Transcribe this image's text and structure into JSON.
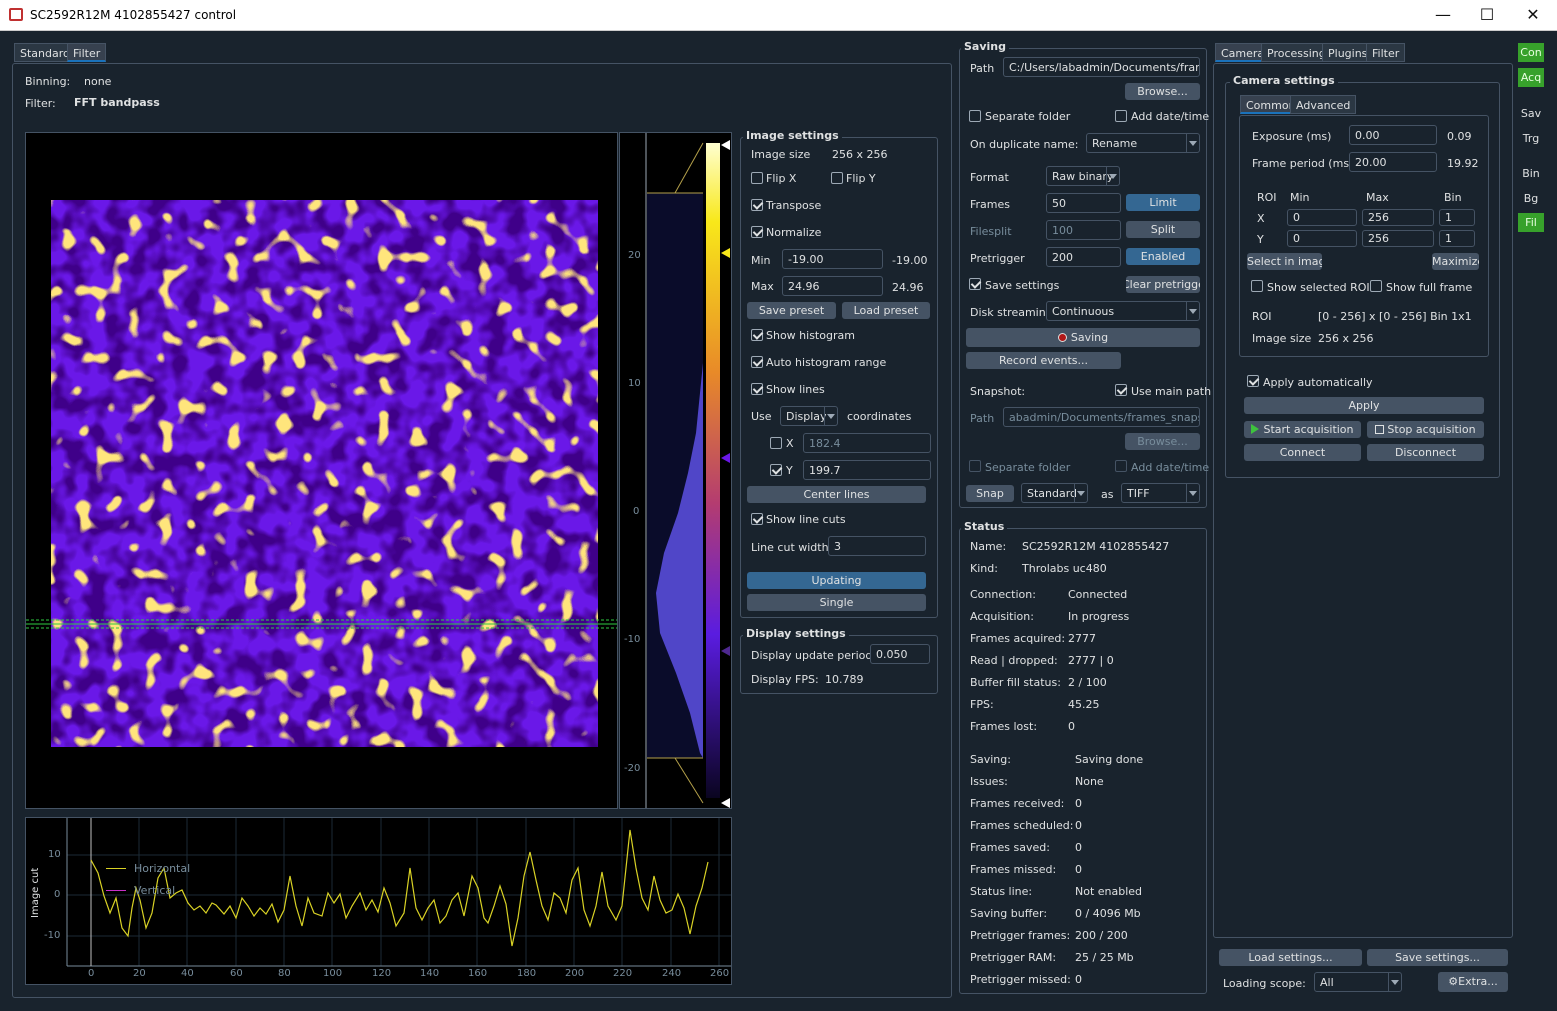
{
  "window": {
    "title": "SC2592R12M 4102855427 control",
    "minimize": "—",
    "maximize": "☐",
    "close": "✕"
  },
  "left_tabs": [
    "Standard",
    "Filter"
  ],
  "filter": {
    "binning_label": "Binning:",
    "binning_value": "none",
    "filter_label": "Filter:",
    "filter_value": "FFT bandpass"
  },
  "image_settings": {
    "title": "Image settings",
    "image_size_label": "Image size",
    "image_size_value": "256 x 256",
    "flip_x": "Flip X",
    "flip_y": "Flip Y",
    "transpose": "Transpose",
    "normalize": "Normalize",
    "min_label": "Min",
    "min_value": "-19.00",
    "min_readout": "-19.00",
    "max_label": "Max",
    "max_value": "24.96",
    "max_readout": "24.96",
    "save_preset": "Save preset",
    "load_preset": "Load preset",
    "show_histogram": "Show histogram",
    "auto_hist": "Auto histogram range",
    "show_lines": "Show lines",
    "use_label": "Use",
    "use_value": "Display",
    "coords_label": "coordinates",
    "x_label": "X",
    "x_value": "182.4",
    "y_label": "Y",
    "y_value": "199.7",
    "center_lines": "Center lines",
    "show_line_cuts": "Show line cuts",
    "line_cut_width_label": "Line cut width",
    "line_cut_width_value": "3",
    "updating": "Updating",
    "single": "Single"
  },
  "display_settings": {
    "title": "Display settings",
    "update_period_label": "Display update period:",
    "update_period_value": "0.050",
    "fps_label": "Display FPS:",
    "fps_value": "10.789"
  },
  "histogram": {
    "ticks": [
      "20",
      "10",
      "0",
      "-10",
      "-20"
    ]
  },
  "linecut": {
    "ylabel": "Image cut",
    "yticks": [
      "10",
      "0",
      "-10"
    ],
    "xticks": [
      "0",
      "20",
      "40",
      "60",
      "80",
      "100",
      "120",
      "140",
      "160",
      "180",
      "200",
      "220",
      "240",
      "260"
    ],
    "legend": [
      "Horizontal",
      "Vertical"
    ],
    "colors": {
      "horizontal": "#d9d225",
      "vertical": "#c830c8"
    }
  },
  "saving": {
    "title": "Saving",
    "path_label": "Path",
    "path_value": "C:/Users/labadmin/Documents/frames",
    "browse": "Browse...",
    "separate_folder": "Separate folder",
    "add_datetime": "Add date/time",
    "on_duplicate_label": "On duplicate name:",
    "on_duplicate_value": "Rename",
    "format_label": "Format",
    "format_value": "Raw binary",
    "frames_label": "Frames",
    "frames_value": "50",
    "limit": "Limit",
    "filesplit_label": "Filesplit",
    "filesplit_value": "100",
    "split": "Split",
    "pretrigger_label": "Pretrigger",
    "pretrigger_value": "200",
    "enabled": "Enabled",
    "save_settings": "Save settings",
    "clear_pretrigger": "Clear pretrigger",
    "disk_streaming_label": "Disk streaming",
    "disk_streaming_value": "Continuous",
    "saving_btn": "Saving",
    "record_events": "Record events...",
    "snapshot_label": "Snapshot:",
    "use_main_path": "Use main path",
    "snap_path_label": "Path",
    "snap_path_value": "abadmin/Documents/frames_snapshot",
    "snap_browse": "Browse...",
    "snap_separate_folder": "Separate folder",
    "snap_add_datetime": "Add date/time",
    "snap": "Snap",
    "snap_mode": "Standard",
    "as_label": "as",
    "snap_format": "TIFF"
  },
  "status": {
    "title": "Status",
    "rows1": [
      [
        "Name:",
        "SC2592R12M 4102855427"
      ],
      [
        "Kind:",
        "Throlabs uc480"
      ]
    ],
    "rows2": [
      [
        "Connection:",
        "Connected"
      ],
      [
        "Acquisition:",
        "In progress"
      ],
      [
        "Frames acquired:",
        "2777"
      ],
      [
        "Read | dropped:",
        "2777 | 0"
      ],
      [
        "Buffer fill status:",
        "2 / 100"
      ],
      [
        "FPS:",
        "45.25"
      ],
      [
        "Frames lost:",
        "0"
      ]
    ],
    "rows3": [
      [
        "Saving:",
        "Saving done"
      ],
      [
        "Issues:",
        "None"
      ],
      [
        "Frames received:",
        "0"
      ],
      [
        "Frames scheduled:",
        "0"
      ],
      [
        "Frames saved:",
        "0"
      ],
      [
        "Frames missed:",
        "0"
      ],
      [
        "Status line:",
        "Not enabled"
      ],
      [
        "Saving buffer:",
        "0 / 4096 Mb"
      ],
      [
        "Pretrigger frames:",
        "200 / 200"
      ],
      [
        "Pretrigger RAM:",
        "25 / 25 Mb"
      ],
      [
        "Pretrigger missed:",
        "0"
      ]
    ]
  },
  "right_tabs": [
    "Camera",
    "Processing",
    "Plugins",
    "Filter"
  ],
  "camera": {
    "title": "Camera settings",
    "subtabs": [
      "Common",
      "Advanced"
    ],
    "exposure_label": "Exposure (ms)",
    "exposure_value": "0.00",
    "exposure_readout": "0.09",
    "frame_period_label": "Frame period (ms)",
    "frame_period_value": "20.00",
    "frame_period_readout": "19.92",
    "roi_head": [
      "ROI",
      "Min",
      "Max",
      "Bin"
    ],
    "roi_x": [
      "X",
      "0",
      "256",
      "1"
    ],
    "roi_y": [
      "Y",
      "0",
      "256",
      "1"
    ],
    "select_in_image": "Select in image",
    "maximize": "Maximize",
    "show_selected_roi": "Show selected ROI",
    "show_full_frame": "Show full frame",
    "roi_label": "ROI",
    "roi_value": "[0 - 256] x [0 - 256]  Bin 1x1",
    "image_size_label": "Image size",
    "image_size_value": "256 x 256",
    "apply_auto": "Apply automatically",
    "apply": "Apply",
    "start_acq": "Start acquisition",
    "stop_acq": "Stop acquisition",
    "connect": "Connect",
    "disconnect": "Disconnect"
  },
  "bottom": {
    "load_settings": "Load settings...",
    "save_settings": "Save settings...",
    "loading_scope_label": "Loading scope:",
    "loading_scope_value": "All",
    "extra": "Extra..."
  },
  "sidebar": [
    "Con",
    "Acq",
    "Sav",
    "Trg",
    "Bin",
    "Bg",
    "Fil"
  ]
}
